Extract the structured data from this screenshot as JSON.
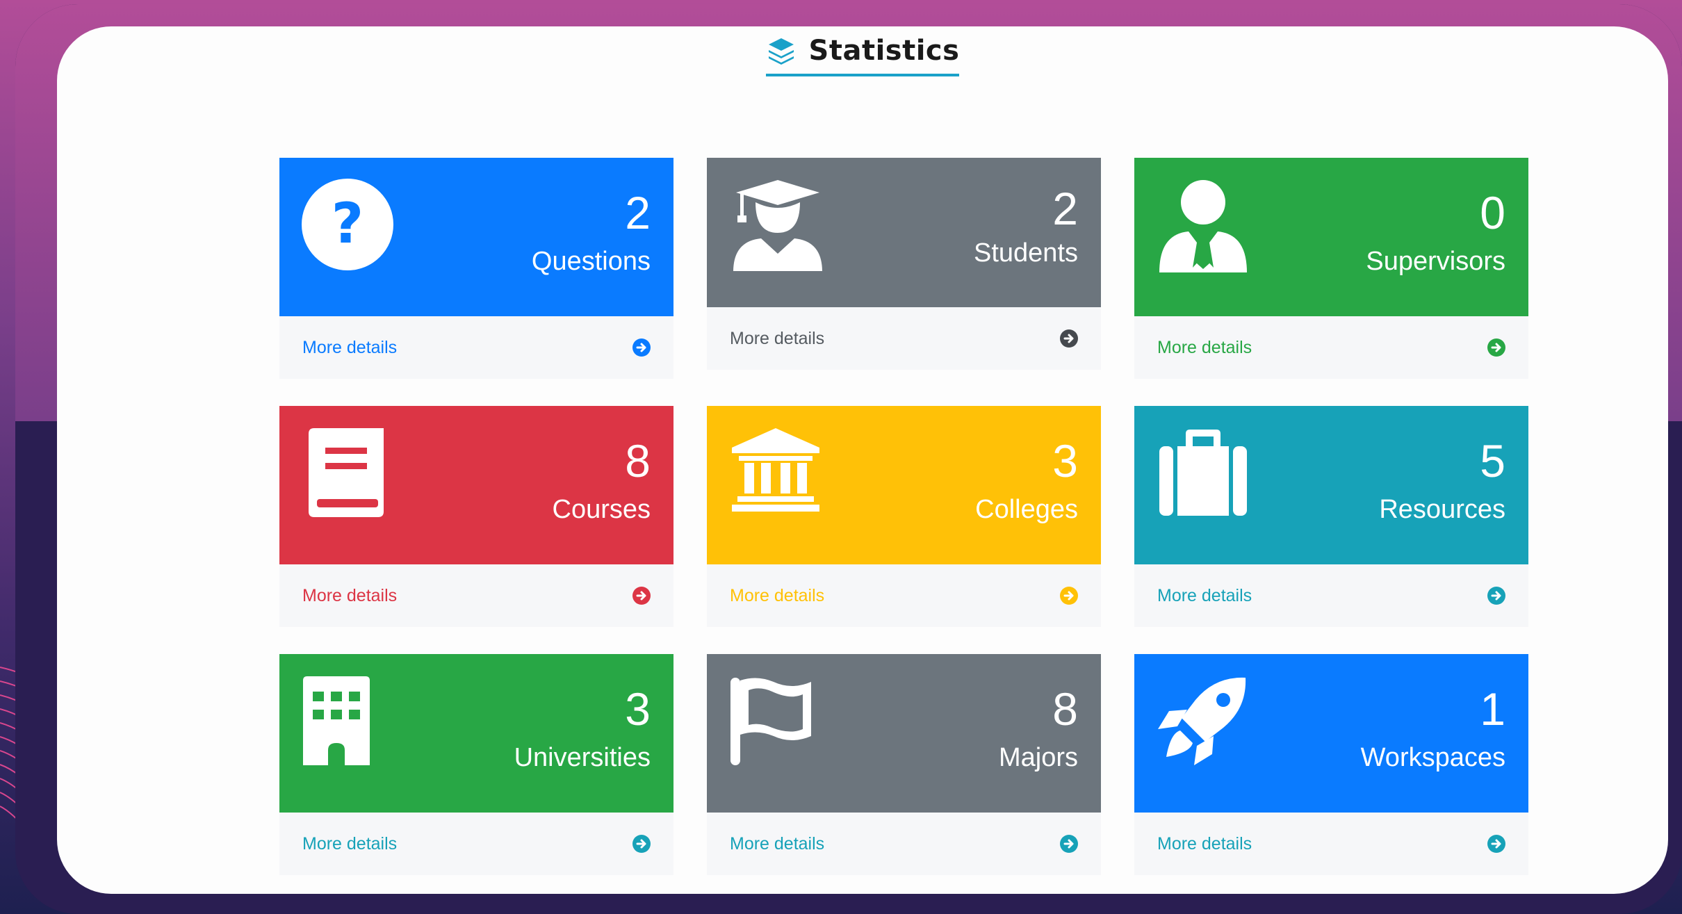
{
  "header": {
    "title": "Statistics",
    "icon": "layers-icon"
  },
  "colors": {
    "blue": "#0a7bff",
    "gray": "#6c757d",
    "green": "#28a745",
    "red": "#dc3545",
    "yellow": "#ffc107",
    "teal": "#17a2b8"
  },
  "cards": [
    {
      "label": "Questions",
      "count": "2",
      "icon": "question-circle-icon",
      "color": "blue",
      "link": "More details"
    },
    {
      "label": "Students",
      "count": "2",
      "icon": "graduate-icon",
      "color": "gray",
      "link": "More details"
    },
    {
      "label": "Supervisors",
      "count": "0",
      "icon": "user-tie-icon",
      "color": "green",
      "link": "More details"
    },
    {
      "label": "Courses",
      "count": "8",
      "icon": "book-icon",
      "color": "red",
      "link": "More details"
    },
    {
      "label": "Colleges",
      "count": "3",
      "icon": "university-icon",
      "color": "yellow",
      "link": "More details"
    },
    {
      "label": "Resources",
      "count": "5",
      "icon": "suitcase-icon",
      "color": "teal",
      "link": "More details"
    },
    {
      "label": "Universities",
      "count": "3",
      "icon": "building-icon",
      "color": "green",
      "link": "More details"
    },
    {
      "label": "Majors",
      "count": "8",
      "icon": "flag-icon",
      "color": "gray",
      "link": "More details"
    },
    {
      "label": "Workspaces",
      "count": "1",
      "icon": "rocket-icon",
      "color": "blue",
      "link": "More details"
    }
  ]
}
